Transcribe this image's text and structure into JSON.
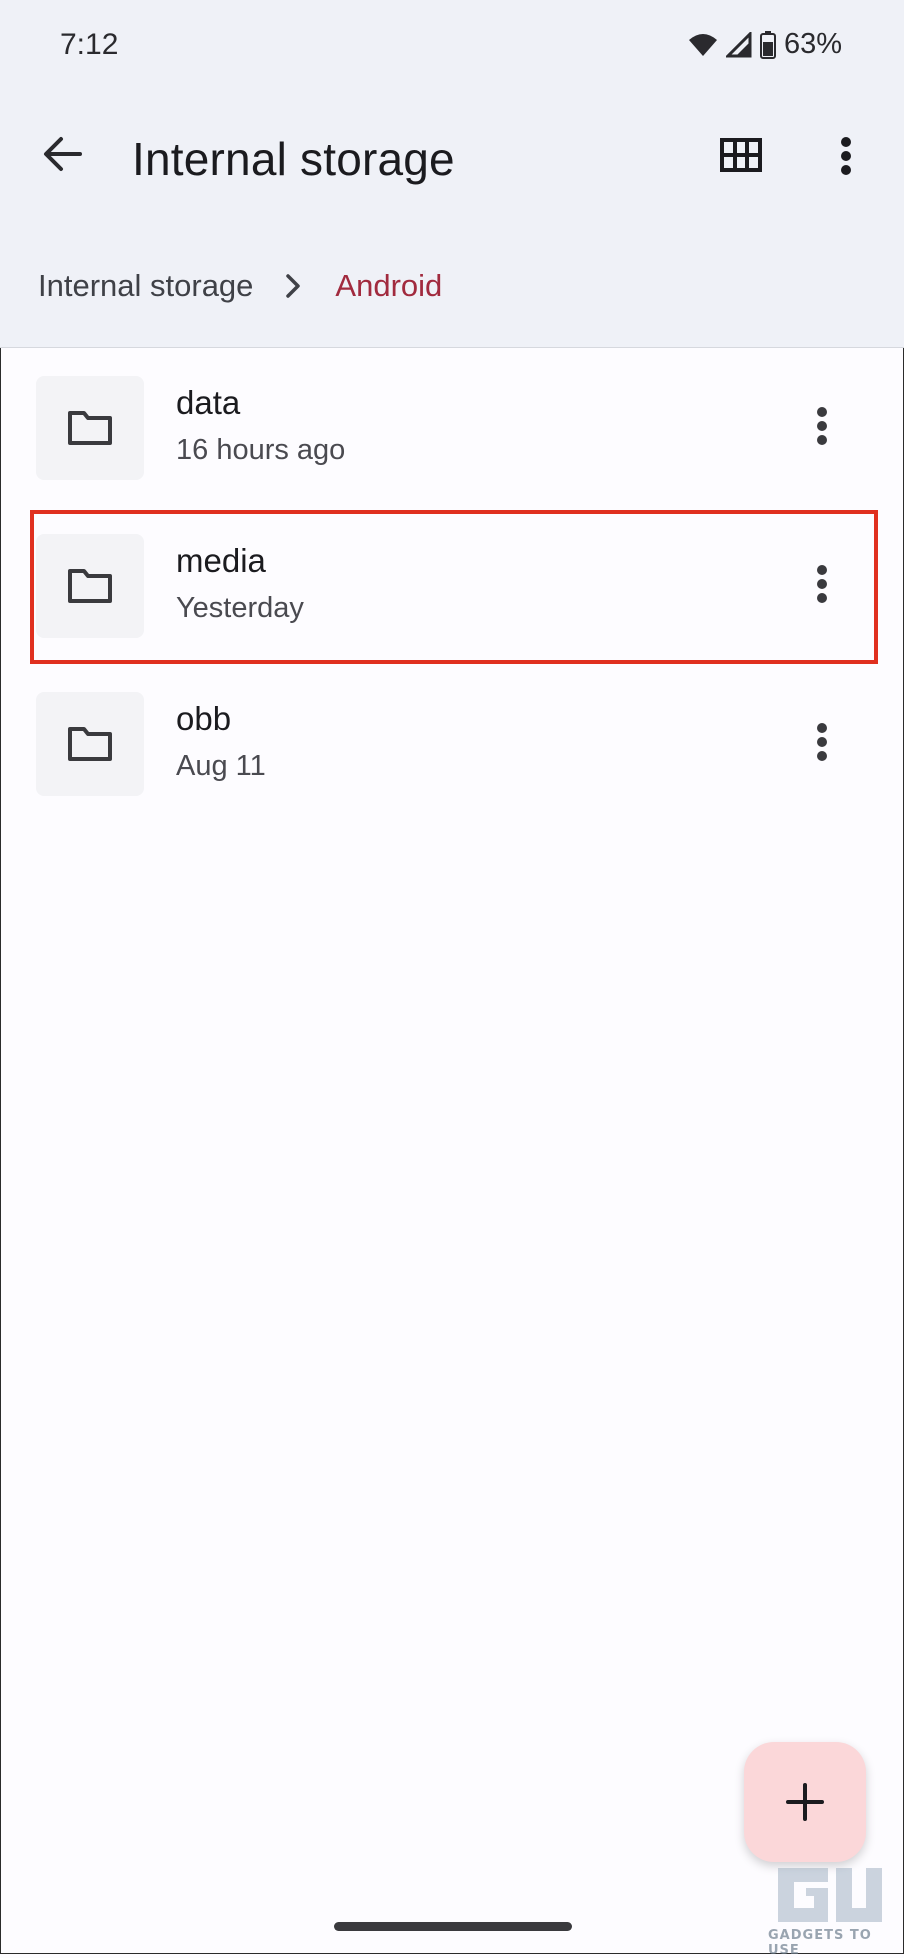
{
  "status_bar": {
    "time": "7:12",
    "battery": "63%",
    "icons": [
      "wifi-icon",
      "signal-icon",
      "battery-icon"
    ]
  },
  "app_bar": {
    "title": "Internal storage",
    "back_icon": "arrow-back-icon",
    "grid_icon": "grid-view-icon",
    "more_icon": "more-vert-icon"
  },
  "breadcrumb": {
    "root": "Internal storage",
    "current": "Android"
  },
  "folders": [
    {
      "name": "data",
      "modified": "16 hours ago"
    },
    {
      "name": "media",
      "modified": "Yesterday",
      "highlighted": true
    },
    {
      "name": "obb",
      "modified": "Aug 11"
    }
  ],
  "fab": {
    "icon": "plus-icon"
  },
  "watermark": {
    "text": "GADGETS TO USE"
  },
  "colors": {
    "topbar_bg": "#eff1f7",
    "accent_crumb": "#a12a3e",
    "highlight_border": "#e0301f",
    "fab_bg": "#fbd7d9"
  }
}
